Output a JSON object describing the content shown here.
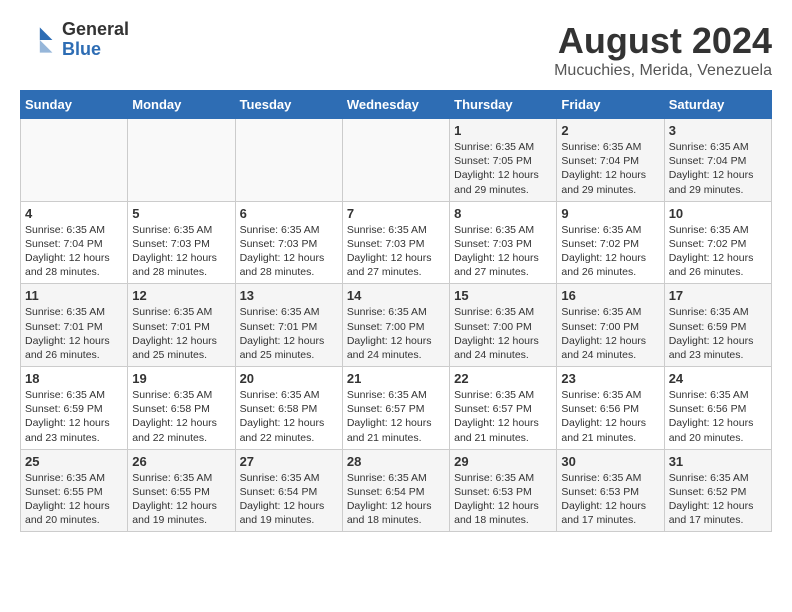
{
  "logo": {
    "general": "General",
    "blue": "Blue"
  },
  "header": {
    "title": "August 2024",
    "subtitle": "Mucuchies, Merida, Venezuela"
  },
  "days_of_week": [
    "Sunday",
    "Monday",
    "Tuesday",
    "Wednesday",
    "Thursday",
    "Friday",
    "Saturday"
  ],
  "weeks": [
    [
      {
        "day": "",
        "info": ""
      },
      {
        "day": "",
        "info": ""
      },
      {
        "day": "",
        "info": ""
      },
      {
        "day": "",
        "info": ""
      },
      {
        "day": "1",
        "info": "Sunrise: 6:35 AM\nSunset: 7:05 PM\nDaylight: 12 hours\nand 29 minutes."
      },
      {
        "day": "2",
        "info": "Sunrise: 6:35 AM\nSunset: 7:04 PM\nDaylight: 12 hours\nand 29 minutes."
      },
      {
        "day": "3",
        "info": "Sunrise: 6:35 AM\nSunset: 7:04 PM\nDaylight: 12 hours\nand 29 minutes."
      }
    ],
    [
      {
        "day": "4",
        "info": "Sunrise: 6:35 AM\nSunset: 7:04 PM\nDaylight: 12 hours\nand 28 minutes."
      },
      {
        "day": "5",
        "info": "Sunrise: 6:35 AM\nSunset: 7:03 PM\nDaylight: 12 hours\nand 28 minutes."
      },
      {
        "day": "6",
        "info": "Sunrise: 6:35 AM\nSunset: 7:03 PM\nDaylight: 12 hours\nand 28 minutes."
      },
      {
        "day": "7",
        "info": "Sunrise: 6:35 AM\nSunset: 7:03 PM\nDaylight: 12 hours\nand 27 minutes."
      },
      {
        "day": "8",
        "info": "Sunrise: 6:35 AM\nSunset: 7:03 PM\nDaylight: 12 hours\nand 27 minutes."
      },
      {
        "day": "9",
        "info": "Sunrise: 6:35 AM\nSunset: 7:02 PM\nDaylight: 12 hours\nand 26 minutes."
      },
      {
        "day": "10",
        "info": "Sunrise: 6:35 AM\nSunset: 7:02 PM\nDaylight: 12 hours\nand 26 minutes."
      }
    ],
    [
      {
        "day": "11",
        "info": "Sunrise: 6:35 AM\nSunset: 7:01 PM\nDaylight: 12 hours\nand 26 minutes."
      },
      {
        "day": "12",
        "info": "Sunrise: 6:35 AM\nSunset: 7:01 PM\nDaylight: 12 hours\nand 25 minutes."
      },
      {
        "day": "13",
        "info": "Sunrise: 6:35 AM\nSunset: 7:01 PM\nDaylight: 12 hours\nand 25 minutes."
      },
      {
        "day": "14",
        "info": "Sunrise: 6:35 AM\nSunset: 7:00 PM\nDaylight: 12 hours\nand 24 minutes."
      },
      {
        "day": "15",
        "info": "Sunrise: 6:35 AM\nSunset: 7:00 PM\nDaylight: 12 hours\nand 24 minutes."
      },
      {
        "day": "16",
        "info": "Sunrise: 6:35 AM\nSunset: 7:00 PM\nDaylight: 12 hours\nand 24 minutes."
      },
      {
        "day": "17",
        "info": "Sunrise: 6:35 AM\nSunset: 6:59 PM\nDaylight: 12 hours\nand 23 minutes."
      }
    ],
    [
      {
        "day": "18",
        "info": "Sunrise: 6:35 AM\nSunset: 6:59 PM\nDaylight: 12 hours\nand 23 minutes."
      },
      {
        "day": "19",
        "info": "Sunrise: 6:35 AM\nSunset: 6:58 PM\nDaylight: 12 hours\nand 22 minutes."
      },
      {
        "day": "20",
        "info": "Sunrise: 6:35 AM\nSunset: 6:58 PM\nDaylight: 12 hours\nand 22 minutes."
      },
      {
        "day": "21",
        "info": "Sunrise: 6:35 AM\nSunset: 6:57 PM\nDaylight: 12 hours\nand 21 minutes."
      },
      {
        "day": "22",
        "info": "Sunrise: 6:35 AM\nSunset: 6:57 PM\nDaylight: 12 hours\nand 21 minutes."
      },
      {
        "day": "23",
        "info": "Sunrise: 6:35 AM\nSunset: 6:56 PM\nDaylight: 12 hours\nand 21 minutes."
      },
      {
        "day": "24",
        "info": "Sunrise: 6:35 AM\nSunset: 6:56 PM\nDaylight: 12 hours\nand 20 minutes."
      }
    ],
    [
      {
        "day": "25",
        "info": "Sunrise: 6:35 AM\nSunset: 6:55 PM\nDaylight: 12 hours\nand 20 minutes."
      },
      {
        "day": "26",
        "info": "Sunrise: 6:35 AM\nSunset: 6:55 PM\nDaylight: 12 hours\nand 19 minutes."
      },
      {
        "day": "27",
        "info": "Sunrise: 6:35 AM\nSunset: 6:54 PM\nDaylight: 12 hours\nand 19 minutes."
      },
      {
        "day": "28",
        "info": "Sunrise: 6:35 AM\nSunset: 6:54 PM\nDaylight: 12 hours\nand 18 minutes."
      },
      {
        "day": "29",
        "info": "Sunrise: 6:35 AM\nSunset: 6:53 PM\nDaylight: 12 hours\nand 18 minutes."
      },
      {
        "day": "30",
        "info": "Sunrise: 6:35 AM\nSunset: 6:53 PM\nDaylight: 12 hours\nand 17 minutes."
      },
      {
        "day": "31",
        "info": "Sunrise: 6:35 AM\nSunset: 6:52 PM\nDaylight: 12 hours\nand 17 minutes."
      }
    ]
  ]
}
